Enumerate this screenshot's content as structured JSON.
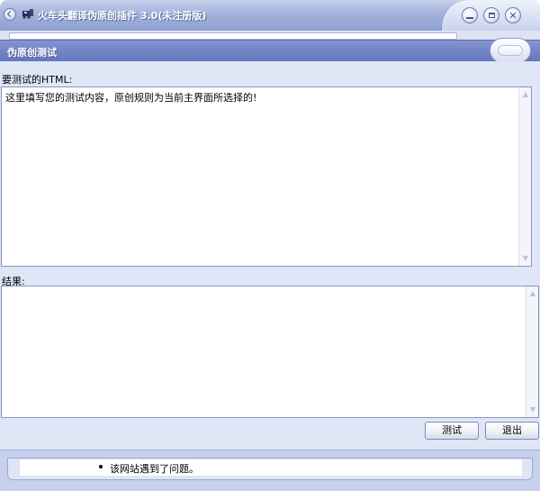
{
  "window": {
    "title": "火车头翻译伪原创插件 3.0(未注册版)"
  },
  "dialog": {
    "title": "伪原创测试",
    "input_label": "要测试的HTML:",
    "input_value": "这里填写您的测试内容，原创规则为当前主界面所选择的!",
    "result_label": "结果:",
    "result_value": "",
    "test_button": "测试",
    "exit_button": "退出"
  },
  "browser": {
    "error_message": "该网站遇到了问题。"
  },
  "icons": {
    "system": "back-circle-icon",
    "app": "train-icon",
    "minimize": "minimize-icon",
    "maximize": "maximize-icon",
    "close": "close-icon"
  },
  "colors": {
    "title_bar": "#7383c6",
    "dialog_body": "#dfe6f6",
    "border": "#8895c2"
  }
}
